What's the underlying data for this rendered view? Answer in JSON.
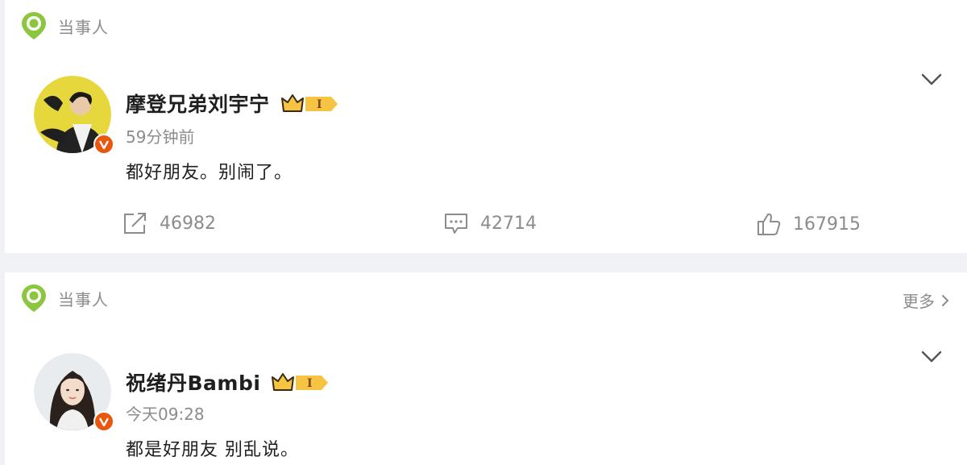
{
  "posts": [
    {
      "section_label": "当事人",
      "username": "摩登兄弟刘宇宁",
      "badge_level": "I",
      "timestamp": "59分钟前",
      "content": "都好朋友。别闹了。",
      "actions": {
        "repost_count": "46982",
        "comment_count": "42714",
        "like_count": "167915"
      }
    },
    {
      "section_label": "当事人",
      "more_label": "更多",
      "username": "祝绪丹Bambi",
      "badge_level": "I",
      "timestamp": "今天09:28",
      "content": "都是好朋友 别乱说。"
    }
  ],
  "icons": {
    "pin": "location-pin-icon",
    "verified": "verified-v-icon",
    "crown": "crown-icon",
    "repost": "repost-icon",
    "comment": "comment-icon",
    "like": "thumbs-up-icon",
    "chevron": "chevron-down-icon"
  },
  "colors": {
    "pin_green": "#8cc63e",
    "verified_orange": "#e8570d",
    "badge_gold": "#f6c343",
    "muted_text": "#8c8c8c",
    "primary_text": "#1f1f1f",
    "page_bg": "#f1f2f5"
  }
}
